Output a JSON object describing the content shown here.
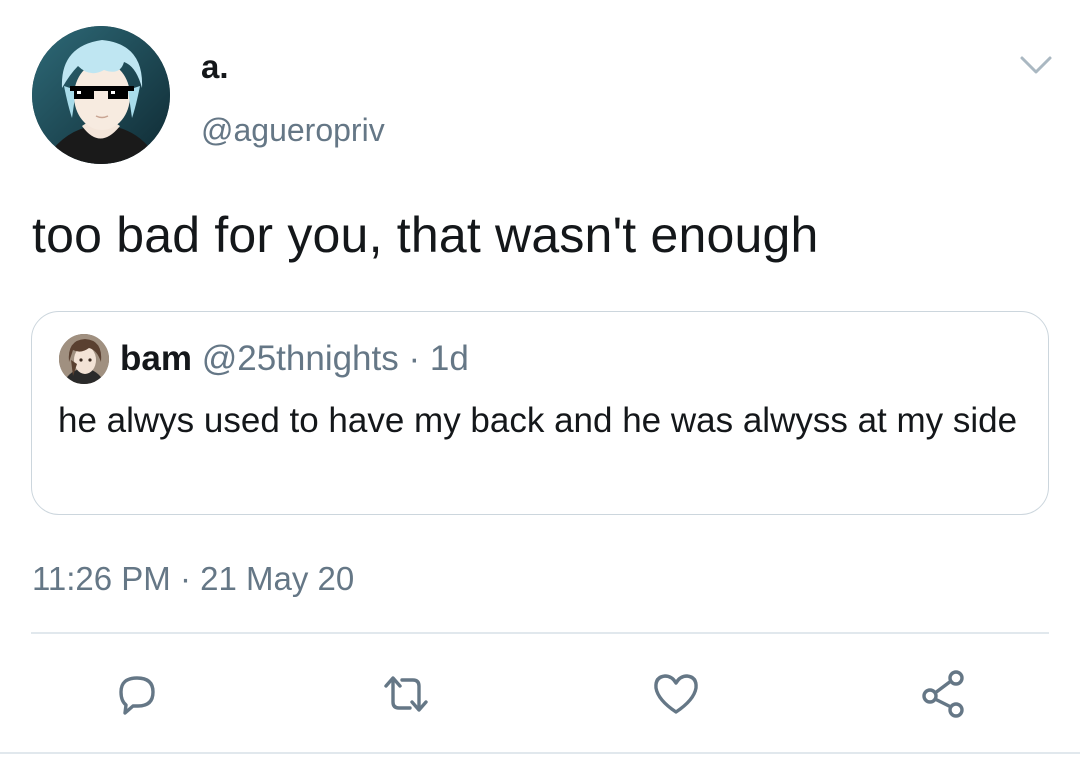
{
  "author": {
    "display_name": "a.",
    "handle": "@agueropriv",
    "avatar_icon": "anime-avatar-with-sunglasses"
  },
  "tweet": {
    "text": "too bad for you, that wasn't enough"
  },
  "quoted_tweet": {
    "display_name": "bam",
    "meta": "@25thnights · 1d",
    "text": "he alwys used to have my back and he was alwyss at my side",
    "avatar_icon": "anime-avatar-brown-hair"
  },
  "timestamp": "11:26 PM · 21 May 20",
  "actions": {
    "reply_icon": "reply-icon",
    "retweet_icon": "retweet-icon",
    "like_icon": "heart-icon",
    "share_icon": "share-icon"
  },
  "colors": {
    "text_primary": "#14171a",
    "text_secondary": "#657786",
    "border": "#ccd6dd",
    "icon": "#657786"
  }
}
